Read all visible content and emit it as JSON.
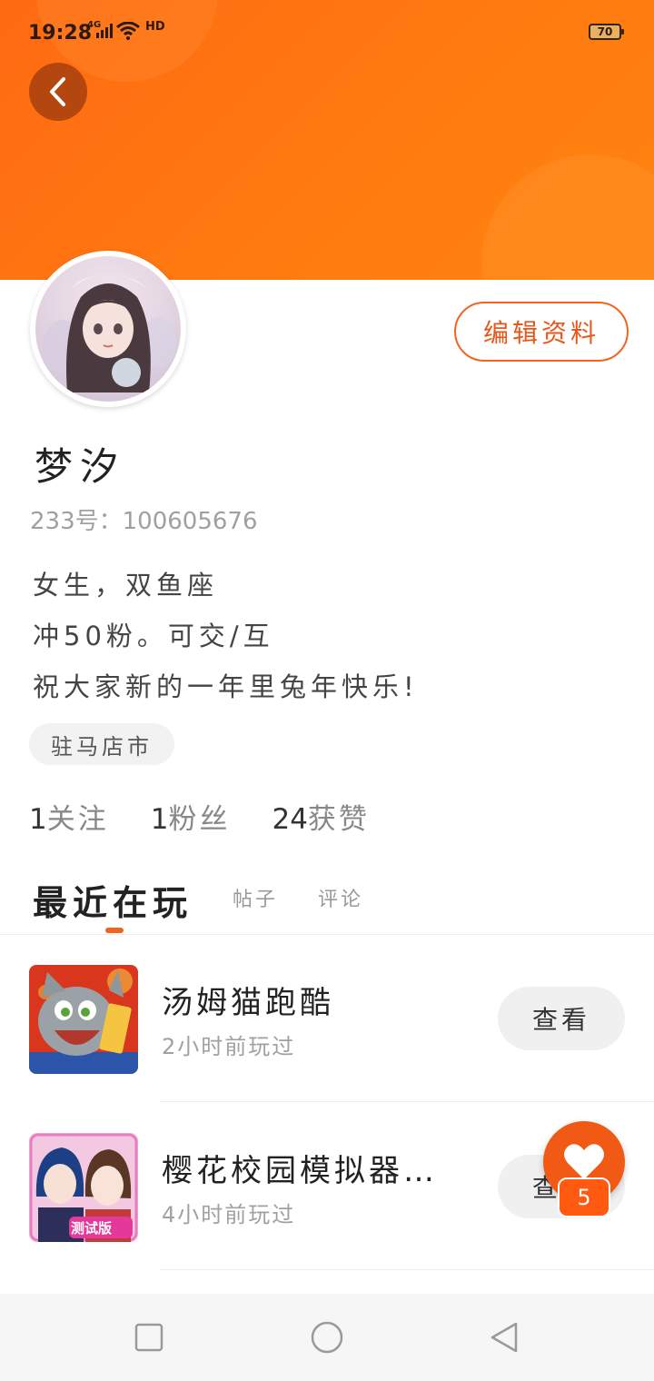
{
  "status_bar": {
    "time": "19:28",
    "network": "4G",
    "hd": "HD",
    "battery": "70"
  },
  "header": {
    "back_icon": "chevron-left-icon"
  },
  "profile": {
    "edit_label": "编辑资料",
    "nickname": "梦汐",
    "uid_text": "233号：100605676",
    "bio": [
      "女生，双鱼座",
      "冲50粉。可交/互",
      "祝大家新的一年里兔年快乐!"
    ],
    "location": "驻马店市",
    "stats": [
      {
        "num": "1",
        "label": "关注"
      },
      {
        "num": "1",
        "label": "粉丝"
      },
      {
        "num": "24",
        "label": "获赞"
      }
    ]
  },
  "tabs": {
    "active": "最近在玩",
    "others": [
      "帖子",
      "评论"
    ]
  },
  "games": [
    {
      "name": "汤姆猫跑酷",
      "played": "2小时前玩过",
      "action": "查看",
      "icon": "talking-tom-game-icon"
    },
    {
      "name": "樱花校园模拟器…",
      "played": "4小时前玩过",
      "action": "查看",
      "icon": "sakura-school-game-icon",
      "icon_badge": "测试版"
    }
  ],
  "fab": {
    "icon": "heart-icon",
    "count": "5"
  },
  "colors": {
    "accent": "#f0641e",
    "header": "#ff7412"
  }
}
